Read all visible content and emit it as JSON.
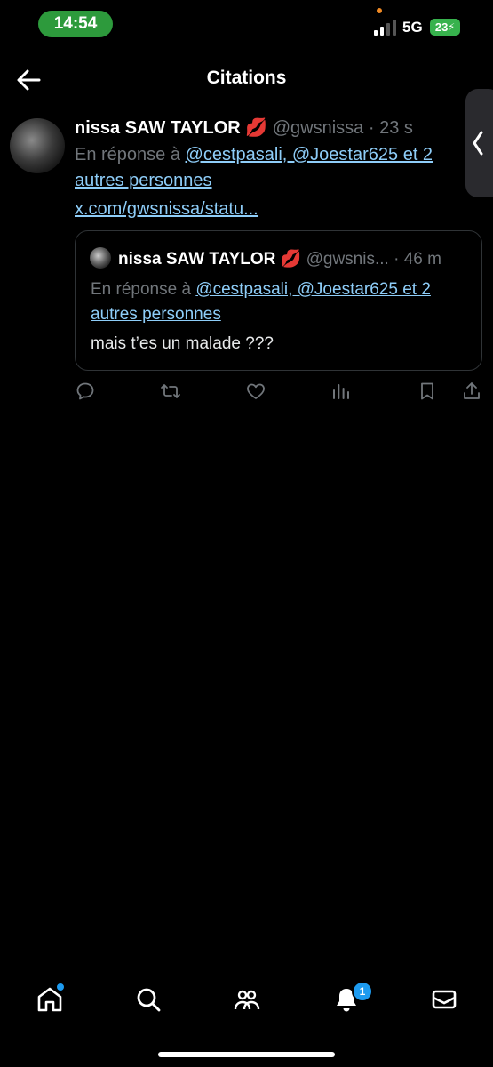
{
  "status_bar": {
    "time": "14:54",
    "network": "5G",
    "battery": "23"
  },
  "header": {
    "title": "Citations"
  },
  "tweet": {
    "author_name": "nissa SAW TAYLOR",
    "author_emoji": "💋",
    "author_meta": "@gwsnissa · 23 s",
    "reply_prefix": "En réponse à ",
    "reply_targets": "@cestpasali, @Joestar625 et 2 autres personnes",
    "link": "x.com/gwsnissa/statu..."
  },
  "quoted_tweet": {
    "author_name": "nissa SAW TAYLOR",
    "author_emoji": "💋",
    "author_meta": "@gwsnis... · 46 m",
    "reply_prefix": "En réponse à ",
    "reply_targets": "@cestpasali, @Joestar625 et 2 autres personnes",
    "text": "mais t’es un malade ???"
  },
  "notifications": {
    "badge_count": "1"
  },
  "icons": [
    "reply-icon",
    "retweet-icon",
    "like-icon",
    "views-icon",
    "bookmark-icon",
    "share-icon",
    "home-icon",
    "search-icon",
    "communities-icon",
    "notifications-icon",
    "messages-icon"
  ],
  "colors": {
    "link": "#8ecdf8",
    "accent": "#1d9bf0",
    "time_pill": "#2d9a3c",
    "muted": "#71767b"
  }
}
